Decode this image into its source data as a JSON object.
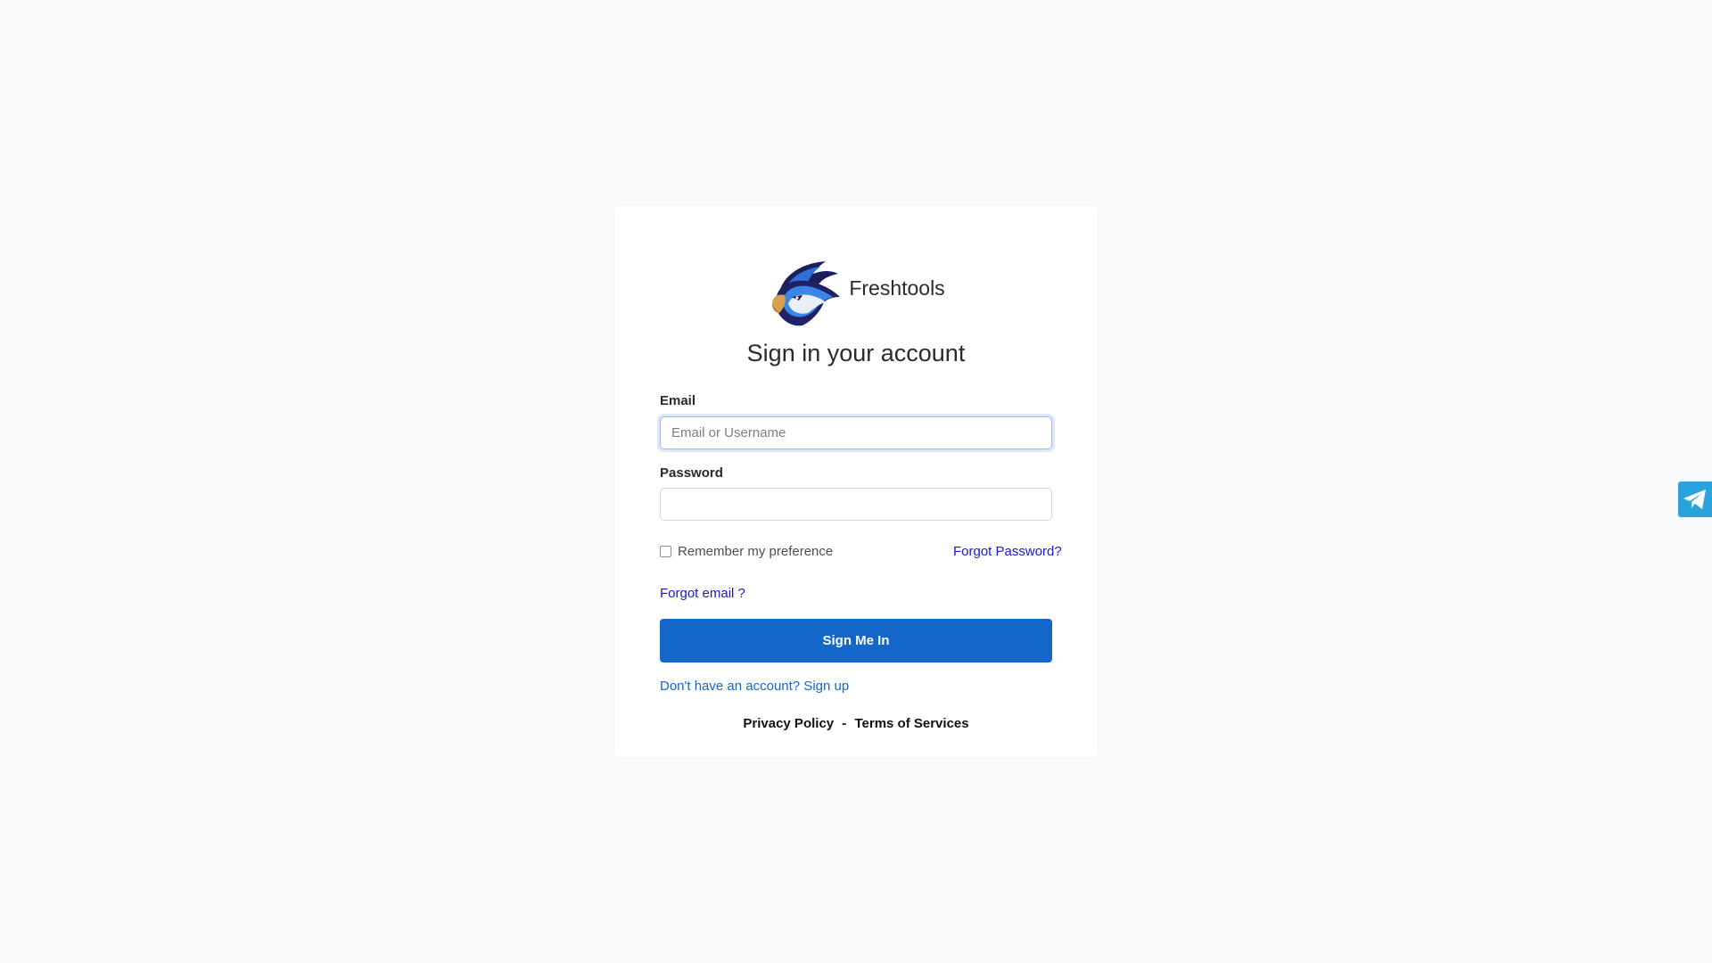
{
  "brand": {
    "name": "Freshtools",
    "logo_icon": "eagle-logo-icon"
  },
  "form": {
    "title": "Sign in your account",
    "email_label": "Email",
    "email_placeholder": "Email or Username",
    "email_value": "",
    "password_label": "Password",
    "password_value": "",
    "remember_label": "Remember my preference",
    "remember_checked": false,
    "forgot_password": "Forgot Password?",
    "forgot_email": "Forgot email ?",
    "submit_label": "Sign Me In",
    "signup_text": "Don't have an account? Sign up"
  },
  "footer": {
    "privacy": "Privacy Policy",
    "separator": "-",
    "terms": "Terms of Services"
  },
  "widgets": {
    "telegram_icon": "telegram-icon"
  },
  "colors": {
    "primary": "#1466c8",
    "link": "#1a19c8",
    "telegram": "#2aa3dc",
    "background": "#f8f9fb"
  }
}
